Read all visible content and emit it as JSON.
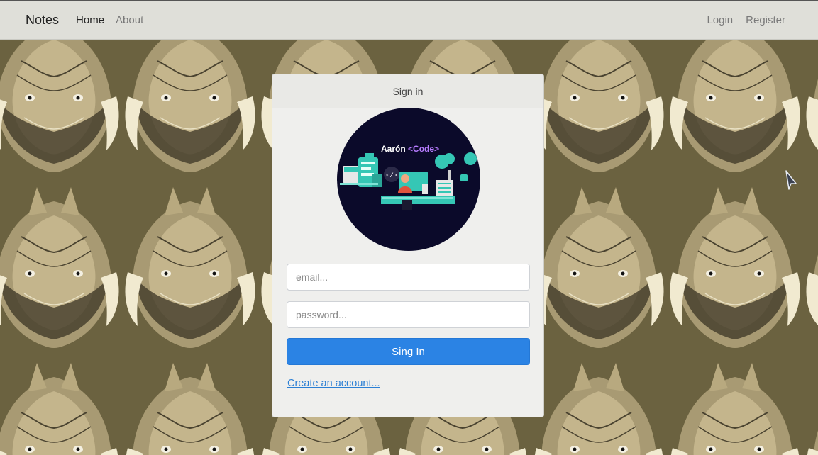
{
  "navbar": {
    "brand": "Notes",
    "links": [
      {
        "label": "Home",
        "active": true
      },
      {
        "label": "About",
        "active": false
      }
    ],
    "right_links": [
      {
        "label": "Login"
      },
      {
        "label": "Register"
      }
    ]
  },
  "signin_card": {
    "header": "Sign in",
    "logo": {
      "title_part1": "Aarón ",
      "title_part2": "<Code>",
      "code_glyph": "</>"
    },
    "email_placeholder": "email...",
    "password_placeholder": "password...",
    "submit_label": "Sing In",
    "create_account_link": "Create an account..."
  },
  "colors": {
    "navbar_bg": "#dfdfd9",
    "card_bg": "#efefed",
    "primary_button": "#2b83e4",
    "link": "#2b7fd4",
    "logo_bg": "#0b0a2a",
    "logo_accent": "#35c7b5",
    "background_pattern": "#6d6442"
  }
}
